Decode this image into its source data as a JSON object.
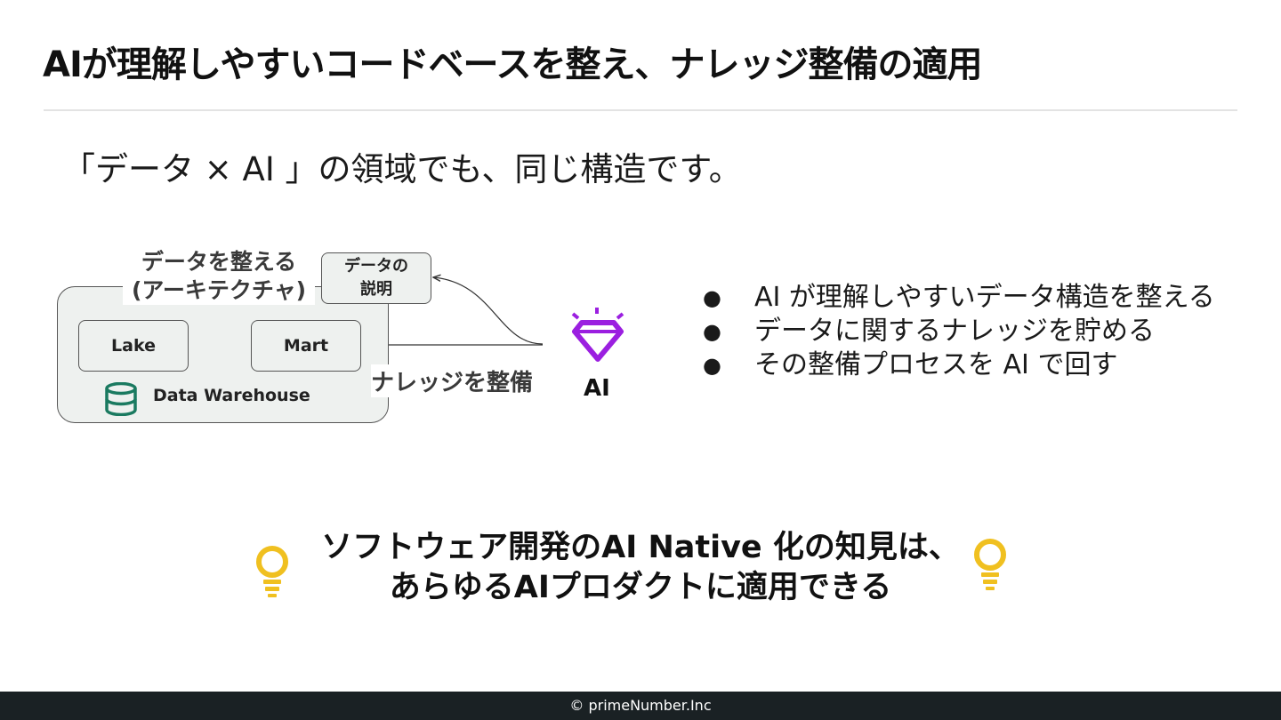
{
  "slide": {
    "title": "AIが理解しやすいコードベースを整え、ナレッジ整備の適用",
    "subtitle": "「データ × AI 」の領域でも、同じ構造です。"
  },
  "diagram": {
    "architecture_label_line1": "データを整える",
    "architecture_label_line2": "(アーキテクチャ)",
    "explanation_line1": "データの",
    "explanation_line2": "説明",
    "lake": "Lake",
    "mart": "Mart",
    "warehouse": "Data Warehouse",
    "knowledge": "ナレッジを整備",
    "ai": "AI",
    "icons": [
      "database-icon",
      "diamond-icon"
    ],
    "colors": {
      "database": "#1a7a60",
      "ai": "#9b1fe0"
    }
  },
  "bullets": [
    {
      "text": "AI が理解しやすいデータ構造を整える"
    },
    {
      "text": "データに関するナレッジを貯める"
    },
    {
      "text": "その整備プロセスを AI で回す"
    }
  ],
  "highlight": {
    "line1": "ソフトウェア開発のAI Native 化の知見は、",
    "line2": "あらゆるAIプロダクトに適用できる",
    "icon": "lightbulb-icon",
    "icon_color": "#f0c020"
  },
  "footer": {
    "copyright": "© primeNumber.Inc"
  }
}
